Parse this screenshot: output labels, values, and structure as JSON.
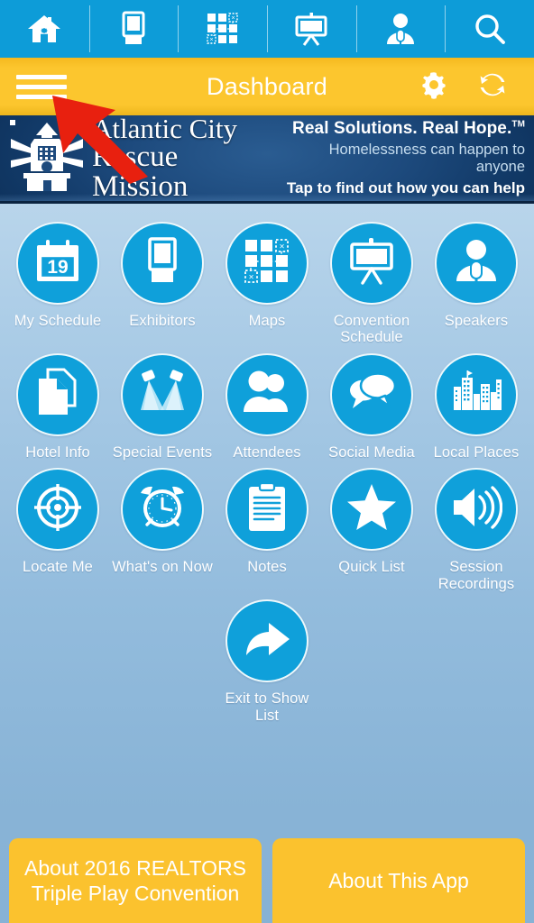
{
  "topbar": {
    "items": [
      {
        "name": "home",
        "label": "Home"
      },
      {
        "name": "exhibitors",
        "label": "Exhibitors"
      },
      {
        "name": "maps",
        "label": "Maps"
      },
      {
        "name": "convention-schedule",
        "label": "Convention Schedule"
      },
      {
        "name": "speakers",
        "label": "Speakers"
      },
      {
        "name": "search",
        "label": "Search"
      }
    ]
  },
  "titlebar": {
    "title": "Dashboard",
    "menu_label": "Menu",
    "settings_label": "Settings",
    "refresh_label": "Refresh"
  },
  "banner": {
    "brand_line1": "Atlantic City",
    "brand_line2": "Rescue Mission",
    "tagline": "Real Solutions. Real Hope.",
    "tagline_mark": "TM",
    "sub1": "Homelessness can happen to anyone",
    "sub2": "Tap to find out how you can help"
  },
  "grid": {
    "rows": [
      [
        {
          "label": "My Schedule",
          "icon": "calendar-icon",
          "badge": "19"
        },
        {
          "label": "Exhibitors",
          "icon": "booth-icon"
        },
        {
          "label": "Maps",
          "icon": "map-grid-icon"
        },
        {
          "label": "Convention Schedule",
          "icon": "easel-icon"
        },
        {
          "label": "Speakers",
          "icon": "speaker-person-icon"
        }
      ],
      [
        {
          "label": "Hotel Info",
          "icon": "documents-icon"
        },
        {
          "label": "Special Events",
          "icon": "spotlights-icon"
        },
        {
          "label": "Attendees",
          "icon": "people-icon"
        },
        {
          "label": "Social Media",
          "icon": "chat-bubbles-icon"
        },
        {
          "label": "Local Places",
          "icon": "city-buildings-icon"
        }
      ],
      [
        {
          "label": "Locate Me",
          "icon": "crosshair-icon"
        },
        {
          "label": "What's on Now",
          "icon": "alarm-clock-icon"
        },
        {
          "label": "Notes",
          "icon": "clipboard-icon"
        },
        {
          "label": "Quick List",
          "icon": "star-icon"
        },
        {
          "label": "Session Recordings",
          "icon": "speaker-volume-icon"
        }
      ]
    ],
    "single": {
      "label": "Exit to Show List",
      "icon": "arrow-exit-icon"
    }
  },
  "bottom": {
    "buttons": [
      {
        "label": "About 2016 REALTORS Triple Play Convention"
      },
      {
        "label": "About This App"
      }
    ]
  },
  "annotation": {
    "type": "red-arrow",
    "points_to": "menu-button"
  },
  "colors": {
    "accent_blue": "#0d9cd8",
    "tile_blue": "#0fa0da",
    "yellow": "#fbc22e",
    "banner_navy": "#123a68",
    "annotation_red": "#e8200f",
    "bg_top": "#d3e4f2",
    "bg_bottom": "#88b3d6"
  }
}
